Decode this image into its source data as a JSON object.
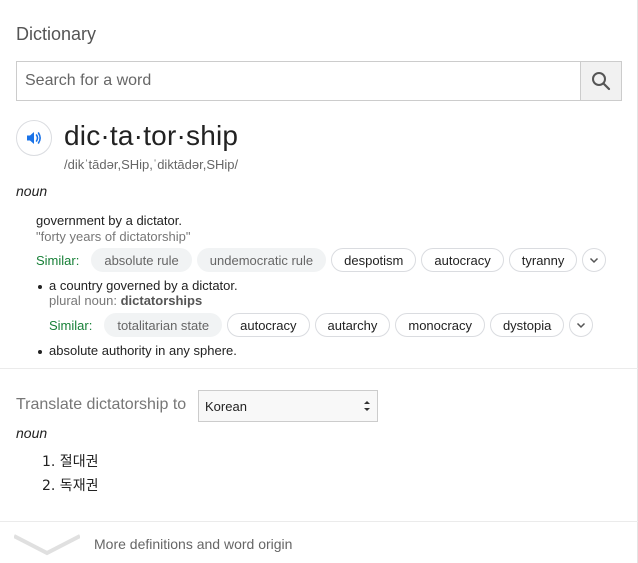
{
  "header": {
    "title": "Dictionary"
  },
  "search": {
    "placeholder": "Search for a word",
    "button_icon": "search-icon"
  },
  "entry": {
    "headword": "dic·ta·tor·ship",
    "phonetic": "/dikˈtādər,SHip,ˈdiktādər,SHip/",
    "part_of_speech": "noun",
    "senses": [
      {
        "definition": "government by a dictator.",
        "example": "\"forty years of dictatorship\"",
        "similar_label": "Similar:",
        "similar": [
          "absolute rule",
          "undemocratic rule",
          "despotism",
          "autocracy",
          "tyranny"
        ]
      },
      {
        "definition": "a country governed by a dictator.",
        "plural_label": "plural noun:",
        "plural_value": "dictatorships",
        "similar_label": "Similar:",
        "similar": [
          "totalitarian state",
          "autocracy",
          "autarchy",
          "monocracy",
          "dystopia"
        ]
      },
      {
        "definition": "absolute authority in any sphere."
      }
    ]
  },
  "translate": {
    "label": "Translate dictatorship to",
    "selected_language": "Korean",
    "part_of_speech": "noun",
    "items": [
      "1. 절대권",
      "2. 독재권"
    ]
  },
  "footer": {
    "more_label": "More definitions and word origin"
  }
}
